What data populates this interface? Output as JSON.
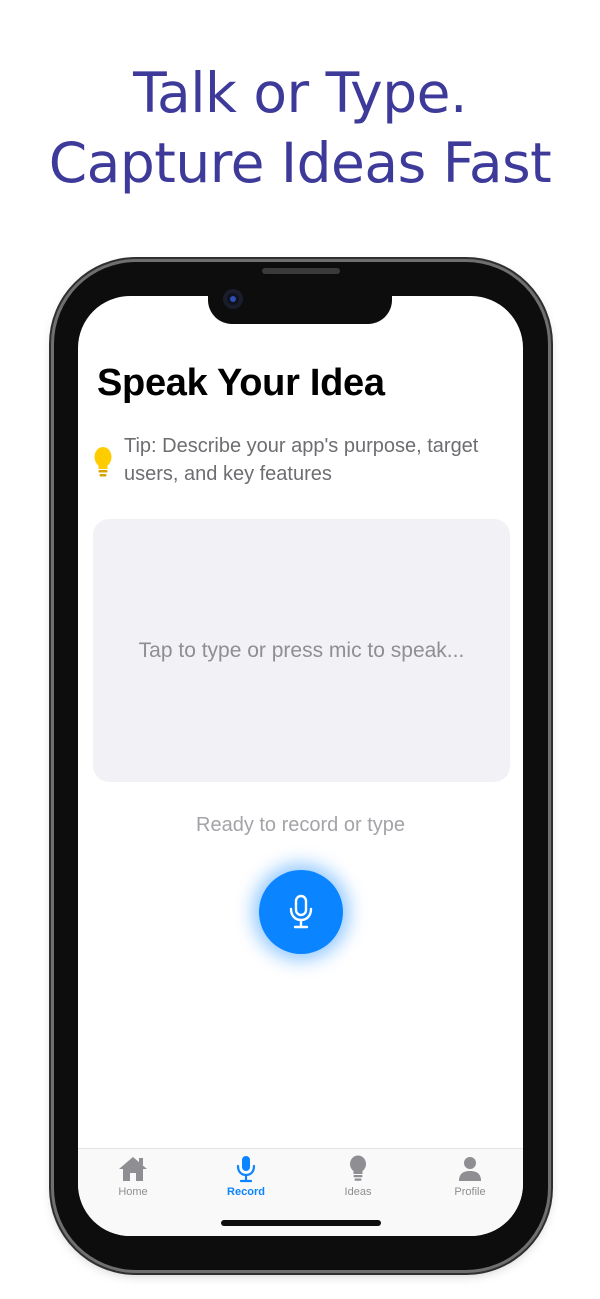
{
  "headline": {
    "line1": "Talk or Type.",
    "line2": "Capture Ideas Fast"
  },
  "screen": {
    "title": "Speak Your Idea",
    "tip": {
      "icon": "lightbulb-icon",
      "text": "Tip: Describe your app's purpose, target users, and key features"
    },
    "input": {
      "placeholder": "Tap to type or press mic to speak..."
    },
    "status": "Ready to record or type",
    "mic_button": {
      "icon": "microphone-icon",
      "color": "#0a84ff"
    }
  },
  "tabbar": {
    "tabs": [
      {
        "label": "Home",
        "icon": "house-icon",
        "active": false
      },
      {
        "label": "Record",
        "icon": "microphone-icon",
        "active": true
      },
      {
        "label": "Ideas",
        "icon": "lightbulb-icon",
        "active": false
      },
      {
        "label": "Profile",
        "icon": "person-icon",
        "active": false
      }
    ]
  },
  "colors": {
    "headline": "#3d3a9a",
    "accent": "#0a84ff",
    "tip_icon": "#ffcc00",
    "input_background": "#f2f2f6"
  }
}
